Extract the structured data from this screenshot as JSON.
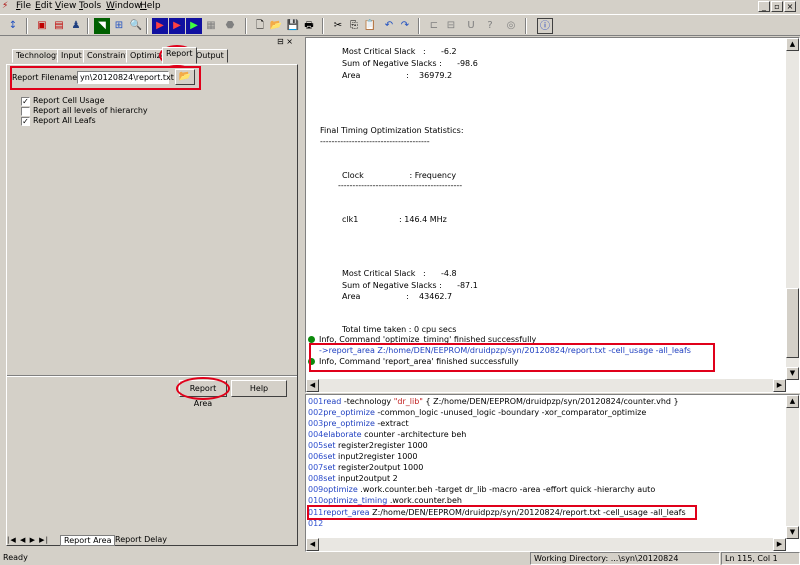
{
  "menu": {
    "items": [
      "File",
      "Edit",
      "View",
      "Tools",
      "Window",
      "Help"
    ]
  },
  "tabs": [
    "Technology",
    "Input",
    "Constraints",
    "Optimize",
    "Report",
    "Output"
  ],
  "active_tab": "Report",
  "report": {
    "filename_label": "Report Filename:",
    "filename_value": "yn\\20120824\\report.txt",
    "options": [
      {
        "label": "Report Cell Usage",
        "checked": true
      },
      {
        "label": "Report all levels of hierarchy",
        "checked": false
      },
      {
        "label": "Report All Leafs",
        "checked": true
      }
    ],
    "report_area_button": "Report Area",
    "help_button": "Help"
  },
  "bottom_tabs": [
    "Report Area",
    "Report Delay"
  ],
  "output_log": {
    "lines": [
      "Most Critical Slack   :      -6.2",
      "Sum of Negative Slacks :      -98.6",
      "Area                  :    36979.2",
      "Final Timing Optimization Statistics:",
      "--------------------------------------",
      "Clock                  : Frequency",
      "-------------------------------------------",
      "clk1                : 146.4 MHz",
      "Most Critical Slack   :      -4.8",
      "Sum of Negative Slacks :      -87.1",
      "Area                  :    43462.7",
      "Total time taken : 0 cpu secs",
      "Info, Command 'optimize_timing' finished successfully",
      "->report_area Z:/home/DEN/EEPROM/druidpzp/syn/20120824/report.txt -cell_usage -all_leafs",
      "Info, Command 'report_area' finished successfully"
    ]
  },
  "script": {
    "lines": [
      {
        "num": "001",
        "cmd": "read",
        "rest": " -technology ",
        "str": "\"dr_lib\"",
        "tail": "  { Z:/home/DEN/EEPROM/druidpzp/syn/20120824/counter.vhd }"
      },
      {
        "num": "002",
        "cmd": "pre_optimize",
        "rest": " -common_logic -unused_logic -boundary -xor_comparator_optimize",
        "str": "",
        "tail": ""
      },
      {
        "num": "003",
        "cmd": "pre_optimize",
        "rest": " -extract",
        "str": "",
        "tail": ""
      },
      {
        "num": "004",
        "cmd": "elaborate",
        "rest": " counter -architecture beh",
        "str": "",
        "tail": ""
      },
      {
        "num": "005",
        "cmd": "set",
        "rest": " register2register 1000",
        "str": "",
        "tail": ""
      },
      {
        "num": "006",
        "cmd": "set",
        "rest": " input2register 1000",
        "str": "",
        "tail": ""
      },
      {
        "num": "007",
        "cmd": "set",
        "rest": " register2output 1000",
        "str": "",
        "tail": ""
      },
      {
        "num": "008",
        "cmd": "set",
        "rest": " input2output 2",
        "str": "",
        "tail": ""
      },
      {
        "num": "009",
        "cmd": "optimize",
        "rest": " .work.counter.beh -target dr_lib -macro -area -effort quick -hierarchy auto",
        "str": "",
        "tail": ""
      },
      {
        "num": "010",
        "cmd": "optimize_timing",
        "rest": " .work.counter.beh",
        "str": "",
        "tail": ""
      },
      {
        "num": "011",
        "cmd": "report_area",
        "rest": " Z:/home/DEN/EEPROM/druidpzp/syn/20120824/report.txt -cell_usage -all_leafs",
        "str": "",
        "tail": ""
      },
      {
        "num": "012",
        "cmd": "",
        "rest": "",
        "str": "",
        "tail": ""
      }
    ]
  },
  "status": {
    "left": "Ready",
    "working_dir": "Working Directory: ...\\syn\\20120824",
    "position": "Ln 115, Col 1"
  },
  "colors": {
    "highlight": "#e0001a",
    "ok_dot": "#0c8a0c",
    "keyword": "#2040c0"
  }
}
